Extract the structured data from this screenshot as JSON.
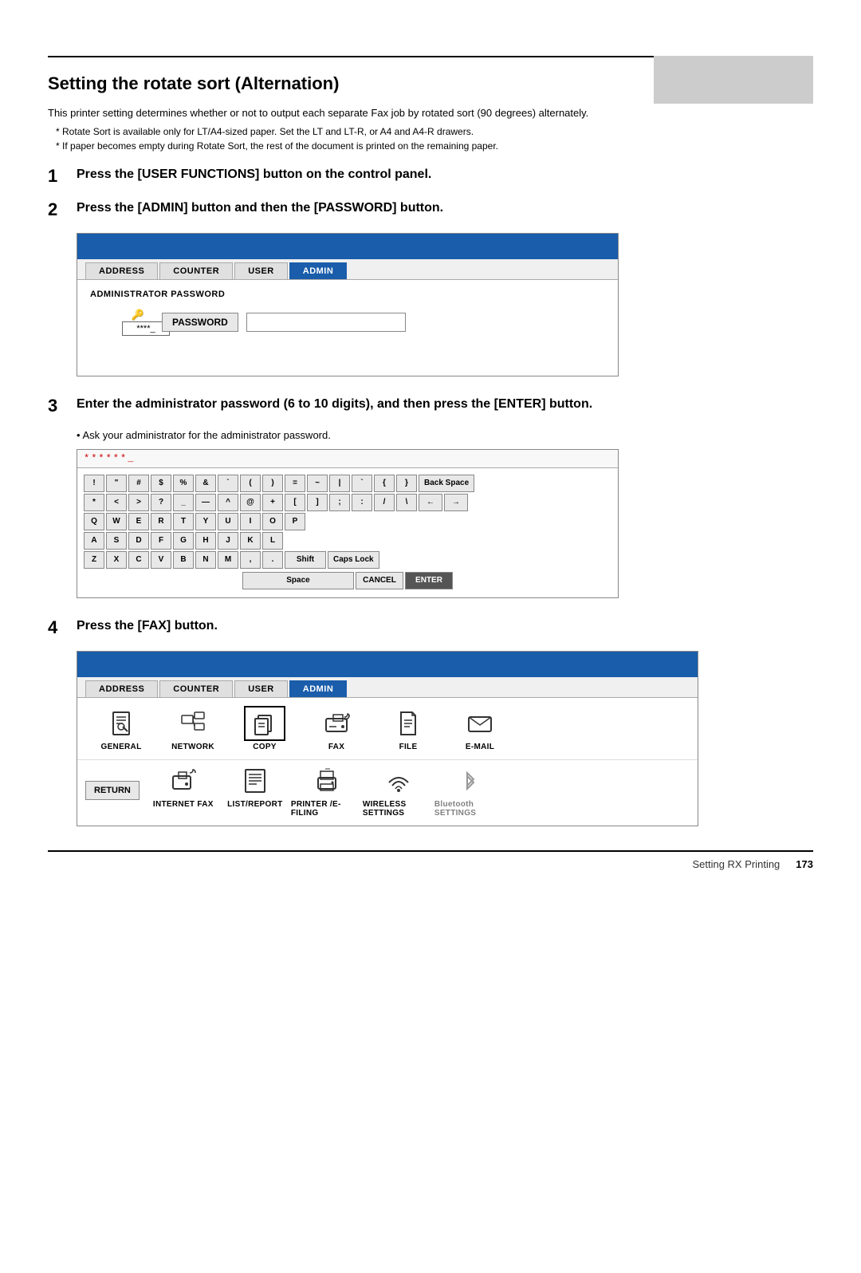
{
  "topBar": {
    "visible": true
  },
  "sectionTitle": "Setting the rotate sort (Alternation)",
  "description": "This printer setting determines whether or not to output each separate Fax job by rotated sort (90 degrees) alternately.",
  "bullets": [
    "Rotate Sort is available only for LT/A4-sized paper. Set the LT and LT-R, or A4 and A4-R drawers.",
    "If paper becomes empty during Rotate Sort, the rest of the document is printed on the remaining paper."
  ],
  "steps": [
    {
      "number": "1",
      "text": "Press the [USER FUNCTIONS] button on the control panel."
    },
    {
      "number": "2",
      "text": "Press the [ADMIN] button and then the [PASSWORD] button."
    },
    {
      "number": "3",
      "text": "Enter the administrator password (6 to 10 digits), and then press the [ENTER] button.",
      "sub": "Ask your administrator for the administrator password."
    },
    {
      "number": "4",
      "text": "Press the [FAX] button."
    }
  ],
  "adminPanel1": {
    "tabs": [
      "ADDRESS",
      "COUNTER",
      "USER",
      "ADMIN"
    ],
    "activeTab": "ADMIN",
    "label": "ADMINISTRATOR PASSWORD",
    "passwordDisplay": "****_",
    "passwordBtnLabel": "PASSWORD"
  },
  "keyboard": {
    "passwordDisplay": "******_",
    "rows": [
      [
        "!",
        "\"",
        "#",
        "$",
        "%",
        "&",
        "`",
        "(",
        ")",
        "=",
        "~",
        "|",
        "`",
        "{",
        "}",
        "Back Space"
      ],
      [
        "*",
        "<",
        ">",
        "?",
        "_",
        "—",
        "^",
        "@",
        "+",
        "[",
        "]",
        ";",
        ":",
        "/",
        "\\",
        "←",
        "→"
      ],
      [
        "Q",
        "W",
        "E",
        "R",
        "T",
        "Y",
        "U",
        "I",
        "O",
        "P"
      ],
      [
        "A",
        "S",
        "D",
        "F",
        "G",
        "H",
        "J",
        "K",
        "L"
      ],
      [
        "Z",
        "X",
        "C",
        "V",
        "B",
        "N",
        "M",
        ",",
        ".",
        "Shift",
        "Caps Lock"
      ],
      [
        "Space",
        "CANCEL",
        "ENTER"
      ]
    ]
  },
  "adminPanel2": {
    "tabs": [
      "ADDRESS",
      "COUNTER",
      "USER",
      "ADMIN"
    ],
    "activeTab": "ADMIN",
    "icons": [
      {
        "label": "GENERAL",
        "icon": "⚙"
      },
      {
        "label": "NETWORK",
        "icon": "🖧"
      },
      {
        "label": "COPY",
        "icon": "📋"
      },
      {
        "label": "FAX",
        "icon": "📠"
      },
      {
        "label": "FILE",
        "icon": "📁"
      },
      {
        "label": "E-MAIL",
        "icon": "✉"
      }
    ],
    "icons2": [
      {
        "label": "INTERNET FAX",
        "icon": "🖨"
      },
      {
        "label": "LIST/REPORT",
        "icon": "📊"
      },
      {
        "label": "PRINTER /E-FILING",
        "icon": "🖨"
      },
      {
        "label": "WIRELESS SETTINGS",
        "icon": "📡"
      },
      {
        "label": "Bluetooth SETTINGS",
        "icon": "🔵"
      }
    ],
    "returnLabel": "RETURN"
  },
  "footer": {
    "text": "Setting RX Printing",
    "pageNumber": "173"
  }
}
